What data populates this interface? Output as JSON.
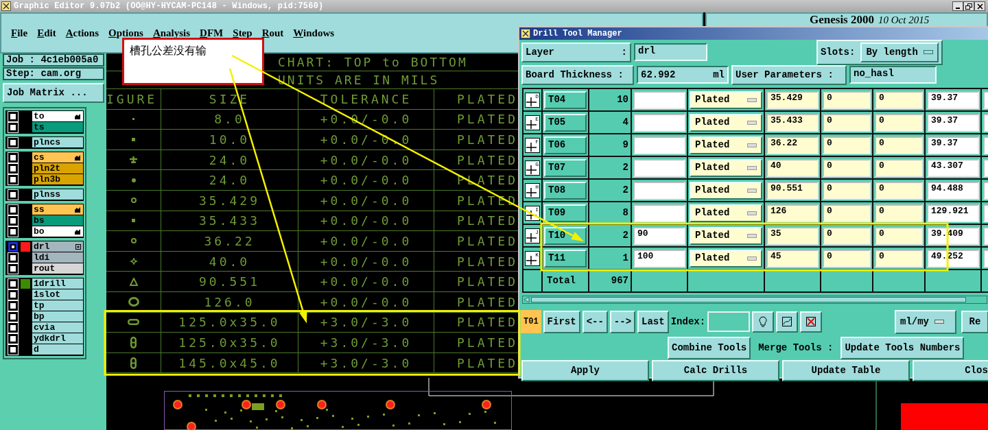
{
  "title_bar": {
    "title": "Graphic Editor 9.07b2 (OO@HY-HYCAM-PC148 - Windows, pid:7560)"
  },
  "menu": [
    {
      "label": "File"
    },
    {
      "label": "Edit"
    },
    {
      "label": "Actions"
    },
    {
      "label": "Options"
    },
    {
      "label": "Analysis"
    },
    {
      "label": "DFM"
    },
    {
      "label": "Step"
    },
    {
      "label": "Rout"
    },
    {
      "label": "Windows"
    }
  ],
  "header": {
    "product": "Genesis 2000",
    "date": "10 Oct 2015"
  },
  "job": "Job : 4c1eb005a0",
  "step": "Step: cam.org",
  "job_matrix_button": "Job Matrix ...",
  "layer_groups": [
    {
      "layers": [
        {
          "name": "to",
          "color": "#ffffff",
          "selected": false,
          "pointer": true
        },
        {
          "name": "ts",
          "color": "#0a9a7c",
          "selected": false
        }
      ]
    },
    {
      "layers": [
        {
          "name": "plncs",
          "color": "#a0dcdc",
          "selected": false
        }
      ]
    },
    {
      "layers": [
        {
          "name": "cs",
          "color": "#ffc451",
          "selected": false,
          "pointer": true
        },
        {
          "name": "pln2t",
          "color": "#d9a400",
          "selected": false
        },
        {
          "name": "pln3b",
          "color": "#d9a400",
          "selected": false
        }
      ]
    },
    {
      "layers": [
        {
          "name": "plnss",
          "color": "#a0dcdc",
          "selected": false
        }
      ]
    },
    {
      "layers": [
        {
          "name": "ss",
          "color": "#ffc451",
          "selected": false,
          "pointer": true
        },
        {
          "name": "bs",
          "color": "#0a9a7c",
          "selected": false
        },
        {
          "name": "bo",
          "color": "#ffffff",
          "selected": false,
          "pointer": true
        }
      ]
    },
    {
      "layers": [
        {
          "name": "drl",
          "color": "#a3b5bd",
          "selected": true,
          "swatch": {
            "color": "#ff1a1a"
          },
          "attributes": true
        },
        {
          "name": "ldi",
          "color": "#a3b5bd",
          "selected": false
        },
        {
          "name": "rout",
          "color": "#d6d6d6",
          "selected": false
        }
      ]
    },
    {
      "layers": [
        {
          "name": "1drill",
          "color": "#a0dcdc",
          "selected": false,
          "swatch": {
            "color": "#3c8c00"
          }
        },
        {
          "name": "1slot",
          "color": "#a0dcdc",
          "selected": false
        },
        {
          "name": "tp",
          "color": "#a0dcdc",
          "selected": false
        },
        {
          "name": "bp",
          "color": "#a0dcdc",
          "selected": false
        },
        {
          "name": "cvia",
          "color": "#a0dcdc",
          "selected": false
        },
        {
          "name": "ydkdrl",
          "color": "#a0dcdc",
          "selected": false
        },
        {
          "name": "d",
          "color": "#a0dcdc",
          "selected": false
        }
      ]
    }
  ],
  "drill_chart": {
    "title": "CHART: TOP to BOTTOM",
    "subtitle": "UNITS ARE IN MILS",
    "columns": [
      "IGURE",
      "SIZE",
      "TOLERANCE",
      "PLATED"
    ],
    "rows": [
      {
        "kind": "dot",
        "size": "8.0",
        "tolerance": "+0.0/-0.0",
        "plated": "PLATED",
        "highlighted": false
      },
      {
        "kind": "square",
        "size": "10.0",
        "tolerance": "+0.0/-0.0",
        "plated": "PLATED",
        "highlighted": false
      },
      {
        "kind": "pad",
        "size": "24.0",
        "tolerance": "+0.0/-0.0",
        "plated": "PLATED",
        "highlighted": false
      },
      {
        "kind": "circle",
        "size": "24.0",
        "tolerance": "+0.0/-0.0",
        "plated": "PLATED",
        "highlighted": false
      },
      {
        "kind": "ring",
        "size": "35.429",
        "tolerance": "+0.0/-0.0",
        "plated": "PLATED",
        "highlighted": false
      },
      {
        "kind": "square",
        "size": "35.433",
        "tolerance": "+0.0/-0.0",
        "plated": "PLATED",
        "highlighted": false
      },
      {
        "kind": "ring",
        "size": "36.22",
        "tolerance": "+0.0/-0.0",
        "plated": "PLATED",
        "highlighted": false
      },
      {
        "kind": "star",
        "size": "40.0",
        "tolerance": "+0.0/-0.0",
        "plated": "PLATED",
        "highlighted": false
      },
      {
        "kind": "triangle",
        "size": "90.551",
        "tolerance": "+0.0/-0.0",
        "plated": "PLATED",
        "highlighted": false
      },
      {
        "kind": "oval",
        "size": "126.0",
        "tolerance": "+0.0/-0.0",
        "plated": "PLATED",
        "highlighted": false
      },
      {
        "kind": "slot-horizontal",
        "size": "125.0x35.0",
        "tolerance": "+3.0/-3.0",
        "plated": "PLATED",
        "highlighted": true
      },
      {
        "kind": "slot-vertical",
        "size": "125.0x35.0",
        "tolerance": "+3.0/-3.0",
        "plated": "PLATED",
        "highlighted": true
      },
      {
        "kind": "slot-vertical",
        "size": "145.0x45.0",
        "tolerance": "+3.0/-3.0",
        "plated": "PLATED",
        "highlighted": true
      }
    ]
  },
  "callout": {
    "text": "槽孔公差没有输"
  },
  "drill_tool_manager": {
    "title": "Drill Tool Manager",
    "layer": {
      "label": "Layer",
      "separator": ":",
      "value": "drl"
    },
    "slots": {
      "label": "Slots:",
      "value": "By length"
    },
    "board_thickness": {
      "label": "Board Thickness :",
      "value": "62.992",
      "unit": "ml"
    },
    "user_parameters": {
      "label": "User Parameters :",
      "value": "no_hasl"
    },
    "tools": [
      {
        "mark": "D",
        "tool": "T04",
        "count": "10",
        "type": "Plated",
        "finish": "35.429",
        "plus": "0",
        "minus": "0",
        "drill": "39.37",
        "highlighted": false
      },
      {
        "mark": "E",
        "tool": "T05",
        "count": "4",
        "type": "Plated",
        "finish": "35.433",
        "plus": "0",
        "minus": "0",
        "drill": "39.37",
        "highlighted": false
      },
      {
        "mark": "F",
        "tool": "T06",
        "count": "9",
        "type": "Plated",
        "finish": "36.22",
        "plus": "0",
        "minus": "0",
        "drill": "39.37",
        "highlighted": false
      },
      {
        "mark": "G",
        "tool": "T07",
        "count": "2",
        "type": "Plated",
        "finish": "40",
        "plus": "0",
        "minus": "0",
        "drill": "43.307",
        "highlighted": false
      },
      {
        "mark": "H",
        "tool": "T08",
        "count": "2",
        "type": "Plated",
        "finish": "90.551",
        "plus": "0",
        "minus": "0",
        "drill": "94.488",
        "highlighted": false
      },
      {
        "mark": "I",
        "tool": "T09",
        "count": "8",
        "type": "Plated",
        "finish": "126",
        "plus": "0",
        "minus": "0",
        "drill": "129.921",
        "highlighted": false
      },
      {
        "mark": "J",
        "tool": "T10",
        "count": "2",
        "slot_length": "90",
        "type": "Plated",
        "finish": "35",
        "plus": "0",
        "minus": "0",
        "drill": "39.409",
        "highlighted": true
      },
      {
        "mark": "K",
        "tool": "T11",
        "count": "1",
        "slot_length": "100",
        "type": "Plated",
        "finish": "45",
        "plus": "0",
        "minus": "0",
        "drill": "49.252",
        "highlighted": true
      }
    ],
    "total": {
      "label": "Total",
      "count": "967"
    },
    "current_tool": "T01",
    "nav_buttons": [
      "First",
      "<--",
      "-->",
      "Last"
    ],
    "index_label": "Index:",
    "units": "ml/my",
    "recalc_button": "Re",
    "combine_button": "Combine Tools",
    "merge_label": "Merge Tools :",
    "update_numbers_button": "Update Tools Numbers",
    "actions": [
      "Apply",
      "Calc Drills",
      "Update Table",
      "Clos"
    ]
  }
}
